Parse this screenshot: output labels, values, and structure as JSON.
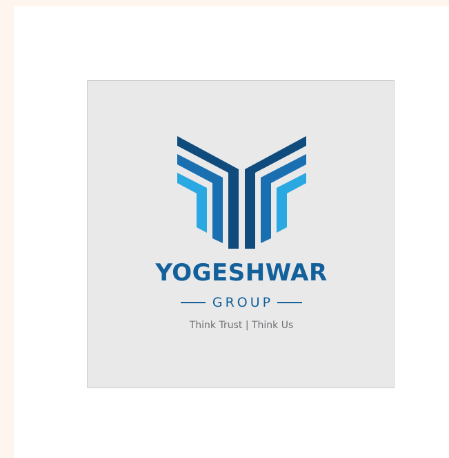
{
  "logo": {
    "brand_name": "YOGESHWAR",
    "group_label": "GROUP",
    "tagline": "Think Trust | Think Us",
    "icon": "yogeshwar-chevron-mark-icon",
    "colors": {
      "dark_blue": "#0f4b7c",
      "mid_blue": "#1a6fb0",
      "light_blue": "#2aa8e2",
      "wordmark": "#13609a",
      "tagline": "#6f6f72",
      "frame_background": "#e9e9ea"
    }
  },
  "page": {
    "background": "#fdf5ee",
    "card_background": "#ffffff"
  }
}
